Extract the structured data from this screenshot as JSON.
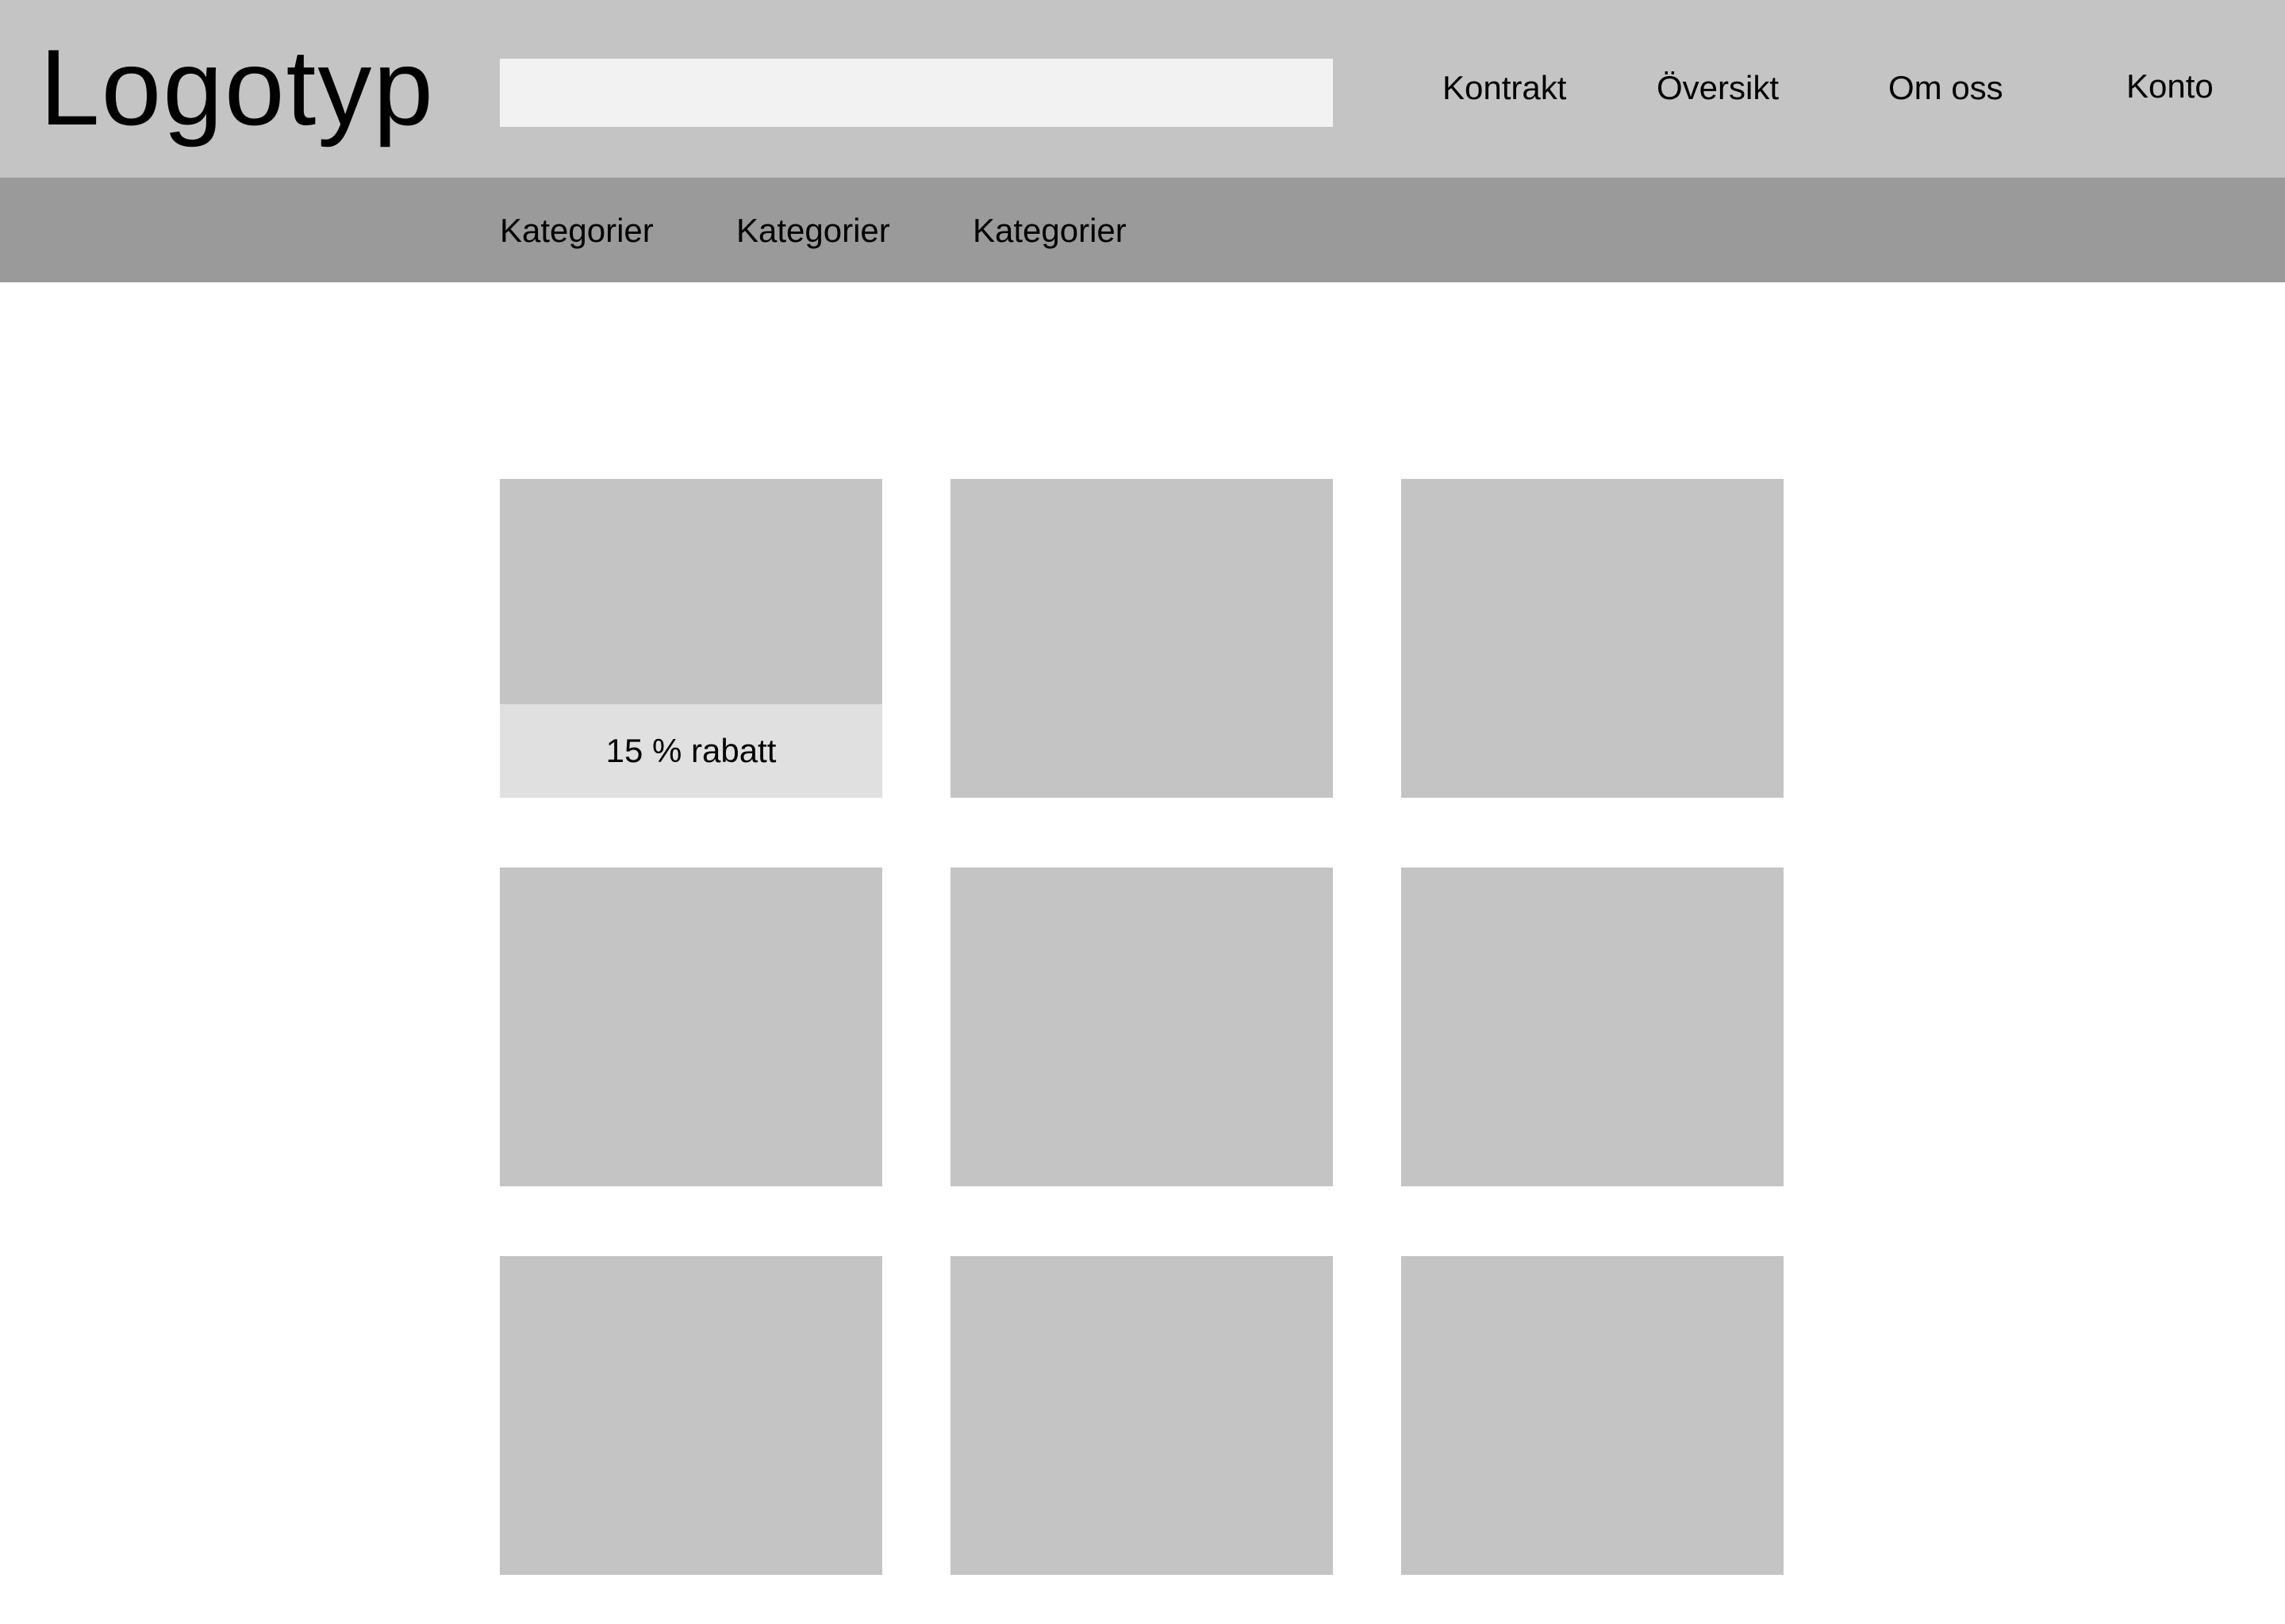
{
  "header": {
    "logo": "Logotyp",
    "search": {
      "value": "",
      "placeholder": ""
    },
    "nav": [
      "Kontrakt",
      "Översikt",
      "Om oss",
      "Konto"
    ]
  },
  "categories": [
    "Kategorier",
    "Kategorier",
    "Kategorier"
  ],
  "products": {
    "tiles": [
      {
        "badge": "15 % rabatt"
      },
      {},
      {},
      {},
      {},
      {},
      {},
      {},
      {}
    ]
  },
  "colors": {
    "header_bg": "#c4c4c4",
    "category_bar_bg": "#9a9a9a",
    "search_bg": "#f2f2f2",
    "tile_bg": "#c4c4c4",
    "badge_bg": "#e0e0e0",
    "text": "#000000"
  }
}
